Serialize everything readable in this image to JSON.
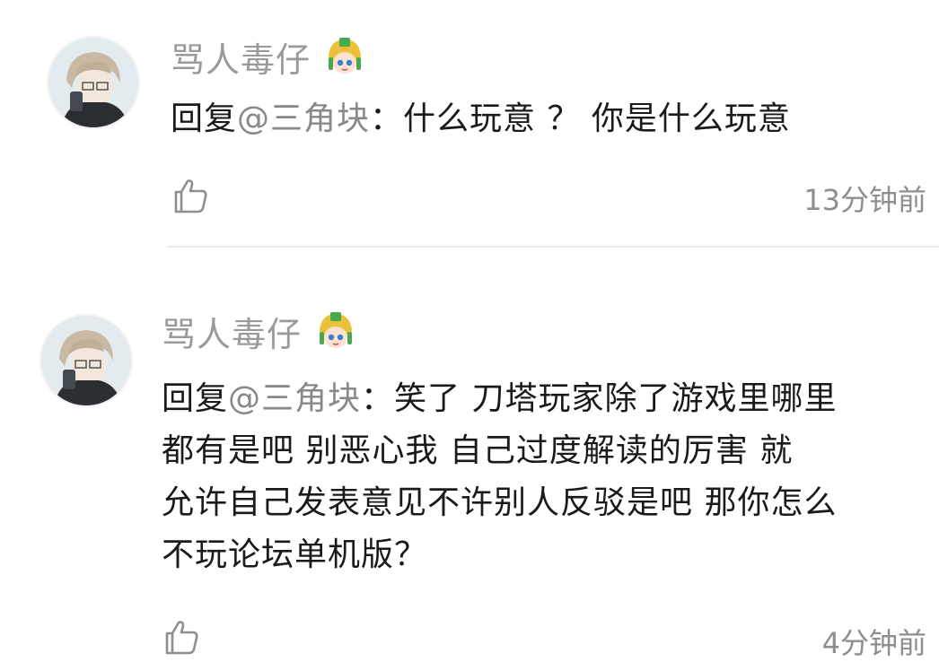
{
  "comments": [
    {
      "username": "骂人毒仔",
      "reply_prefix": "回复",
      "mention": "@三角块",
      "colon": "：",
      "text": "什么玩意 ？ 你是什么玩意",
      "time": "13分钟前",
      "badge_icon": "anime-girl-badge-icon",
      "like_icon": "thumbs-up-icon"
    },
    {
      "username": "骂人毒仔",
      "reply_prefix": "回复",
      "mention": "@三角块",
      "colon": "：",
      "text_lines": [
        "笑了  刀塔玩家除了游戏里哪里",
        "都有是吧  别恶心我  自己过度解读的厉害  就",
        "允许自己发表意见不许别人反驳是吧 那你怎么",
        "不玩论坛单机版？"
      ],
      "time": "4分钟前",
      "badge_icon": "anime-girl-badge-icon",
      "like_icon": "thumbs-up-icon"
    }
  ],
  "colors": {
    "username": "#9a9a9a",
    "text": "#1a1a1a",
    "mention_tag": "#888888",
    "time": "#8e8e8e",
    "divider": "#ececec"
  }
}
